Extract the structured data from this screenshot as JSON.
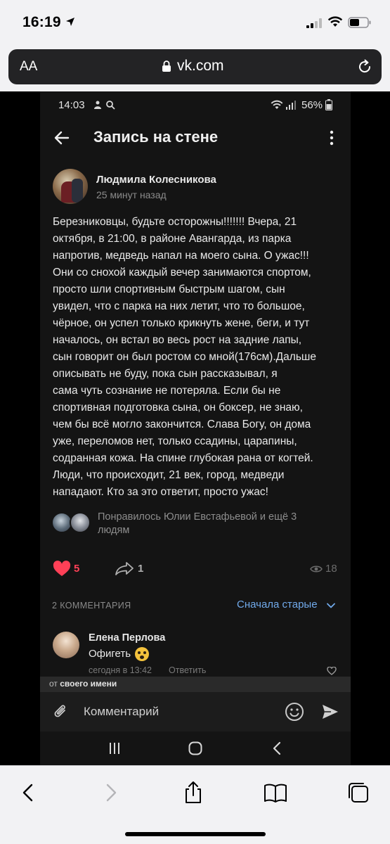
{
  "ios_status": {
    "time": "16:19"
  },
  "safari": {
    "text_size_label": "AA",
    "url": "vk.com"
  },
  "android_status": {
    "time": "14:03",
    "battery": "56%"
  },
  "header": {
    "title": "Запись на стене"
  },
  "post": {
    "author": "Людмила Колесникова",
    "time": "25 минут назад",
    "text": "Березниковцы, будьте осторожны!!!!!!! Вчера, 21\nоктября, в 21:00, в районе Авангарда, из парка\nнапротив, медведь напал на моего сына. О ужас!!!\nОни со снохой каждый вечер занимаются спортом,\nпросто шли спортивным быстрым шагом, сын\nувидел, что с парка на них летит, что то большое,\nчёрное, он успел только крикнуть жене, беги, и тут\nначалось, он встал во весь рост на задние лапы,\nсын говорит он был ростом со мной(176см).Дальше\nописывать не буду, пока сын рассказывал, я\nсама чуть сознание не потеряла. Если бы не\nспортивная подготовка сына, он боксер, не знаю,\nчем бы всё могло закончится. Слава Богу, он дома\nуже, переломов нет, только ссадины, царапины,\nсодранная кожа. На спине глубокая рана от когтей.\nЛюди, что происходит, 21 век, город, медведи\nнападают. Кто за это ответит, просто ужас!",
    "likes_text": "Понравилось Юлии Евстафьевой и ещё 3 людям",
    "like_count": "5",
    "share_count": "1",
    "views": "18"
  },
  "comments_section": {
    "count_label": "2 КОММЕНТАРИЯ",
    "sort_label": "Сначала старые"
  },
  "comment": {
    "author": "Елена Перлова",
    "text": "Офигеть",
    "time": "сегодня в 13:42",
    "reply_label": "Ответить"
  },
  "from_bar": {
    "prefix": "от",
    "name": "своего имени"
  },
  "compose": {
    "placeholder": "Комментарий"
  },
  "colors": {
    "accent": "#71aaeb",
    "like": "#ff4057",
    "background": "#141414"
  }
}
